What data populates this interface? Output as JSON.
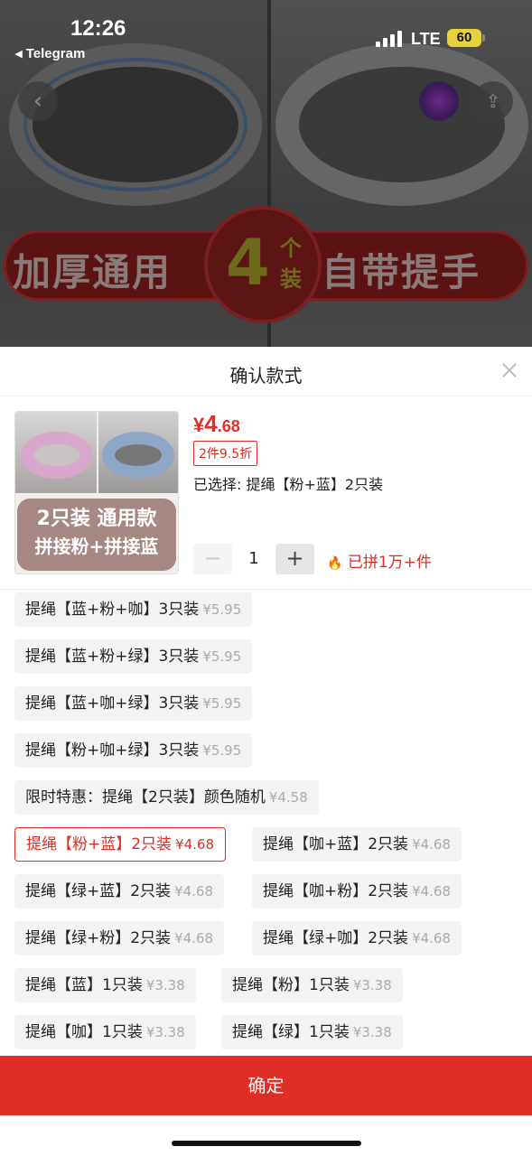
{
  "status_bar": {
    "time": "12:26",
    "back_app": "◂ Telegram",
    "network": "LTE",
    "battery": "60"
  },
  "background": {
    "banner_left": "加厚通用",
    "banner_num": "4",
    "banner_unit": "个装",
    "banner_right": "自带提手"
  },
  "sheet": {
    "title": "确认款式",
    "product": {
      "thumb_line1": "2只装 通用款",
      "thumb_line2": "拼接粉+拼接蓝",
      "price_currency": "¥",
      "price_int": "4",
      "price_dec": ".68",
      "discount": "2件9.5折",
      "selected": "已选择: 提绳【粉+蓝】2只装"
    },
    "stepper": {
      "minus": "−",
      "value": "1",
      "plus": "+"
    },
    "sold": "已拼1万+件",
    "options": [
      {
        "label": "提绳【蓝+粉+咖】3只装",
        "price": "¥5.95"
      },
      {
        "label": "提绳【蓝+粉+绿】3只装",
        "price": "¥5.95"
      },
      {
        "label": "提绳【蓝+咖+绿】3只装",
        "price": "¥5.95"
      },
      {
        "label": "提绳【粉+咖+绿】3只装",
        "price": "¥5.95"
      },
      {
        "label": "限时特惠：提绳【2只装】颜色随机",
        "price": "¥4.58"
      },
      {
        "label": "提绳【粉+蓝】2只装",
        "price": "¥4.68",
        "selected": true
      },
      {
        "label": "提绳【咖+蓝】2只装",
        "price": "¥4.68"
      },
      {
        "label": "提绳【绿+蓝】2只装",
        "price": "¥4.68"
      },
      {
        "label": "提绳【咖+粉】2只装",
        "price": "¥4.68"
      },
      {
        "label": "提绳【绿+粉】2只装",
        "price": "¥4.68"
      },
      {
        "label": "提绳【绿+咖】2只装",
        "price": "¥4.68"
      },
      {
        "label": "提绳【蓝】1只装",
        "price": "¥3.38"
      },
      {
        "label": "提绳【粉】1只装",
        "price": "¥3.38"
      },
      {
        "label": "提绳【咖】1只装",
        "price": "¥3.38"
      },
      {
        "label": "提绳【绿】1只装",
        "price": "¥3.38"
      }
    ],
    "confirm_label": "确定"
  },
  "colors": {
    "accent": "#e02e24",
    "battery": "#e8d23c",
    "thumb_label_bg": "#a58784"
  }
}
